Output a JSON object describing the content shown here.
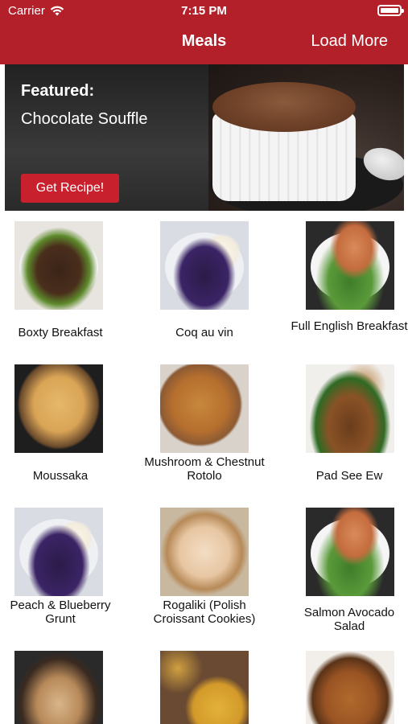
{
  "status_bar": {
    "carrier": "Carrier",
    "time": "7:15 PM"
  },
  "nav": {
    "title": "Meals",
    "right_action": "Load More"
  },
  "featured": {
    "label": "Featured:",
    "title": "Chocolate Souffle",
    "button": "Get Recipe!"
  },
  "meals": [
    {
      "name": "Boxty Breakfast"
    },
    {
      "name": "Coq au vin"
    },
    {
      "name": "Full English Breakfast"
    },
    {
      "name": "Moussaka"
    },
    {
      "name": "Mushroom & Chestnut Rotolo"
    },
    {
      "name": "Pad See Ew"
    },
    {
      "name": "Peach & Blueberry Grunt"
    },
    {
      "name": "Rogaliki (Polish Croissant Cookies)"
    },
    {
      "name": "Salmon Avocado Salad"
    },
    {
      "name": ""
    },
    {
      "name": ""
    },
    {
      "name": ""
    }
  ],
  "colors": {
    "accent": "#b3202a",
    "button": "#c8202c"
  },
  "icons": {
    "wifi": "wifi-icon",
    "battery": "battery-icon"
  }
}
